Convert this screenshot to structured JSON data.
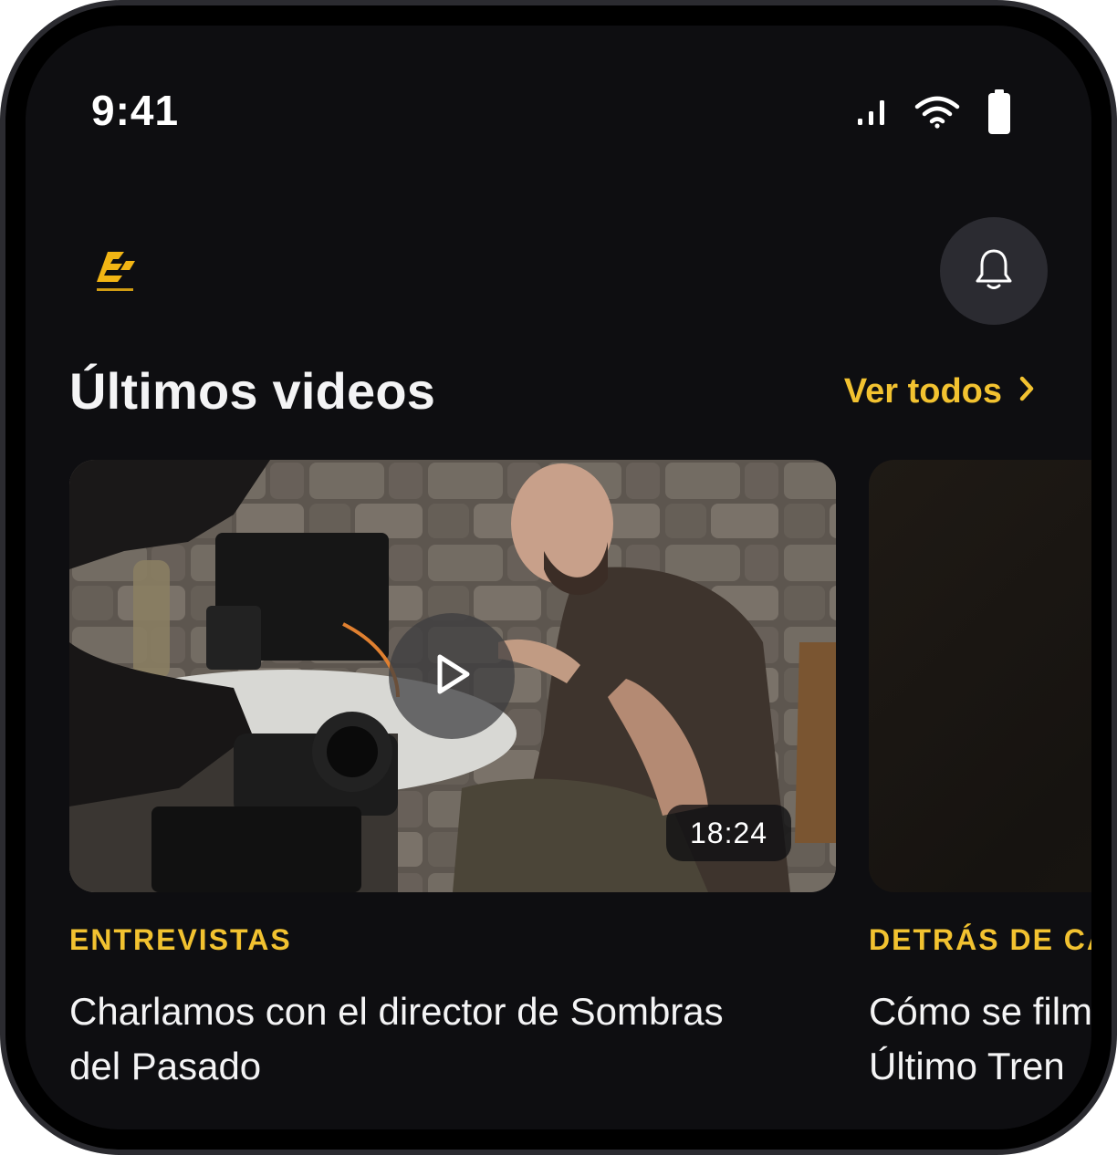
{
  "status_bar": {
    "time": "9:41",
    "icons": [
      "signal-icon",
      "wifi-icon",
      "battery-icon"
    ]
  },
  "header": {
    "logo": "brand-logo",
    "notifications_icon": "bell-icon"
  },
  "section": {
    "title": "Últimos videos",
    "see_all_label": "Ver todos",
    "see_all_icon": "chevron-right-icon"
  },
  "videos": [
    {
      "category": "ENTREVISTAS",
      "title_line1": "Charlamos con el director de Sombras",
      "title_line2": "del Pasado",
      "duration": "18:24",
      "play_icon": "play-icon"
    },
    {
      "category": "DETRÁS DE CÁMARAS",
      "title_line1": "Cómo se filmó",
      "title_line2": "Último Tren"
    }
  ],
  "colors": {
    "background": "#0e0e11",
    "accent": "#f2c230",
    "surface": "#2b2b31",
    "text": "#f4f4f5"
  }
}
